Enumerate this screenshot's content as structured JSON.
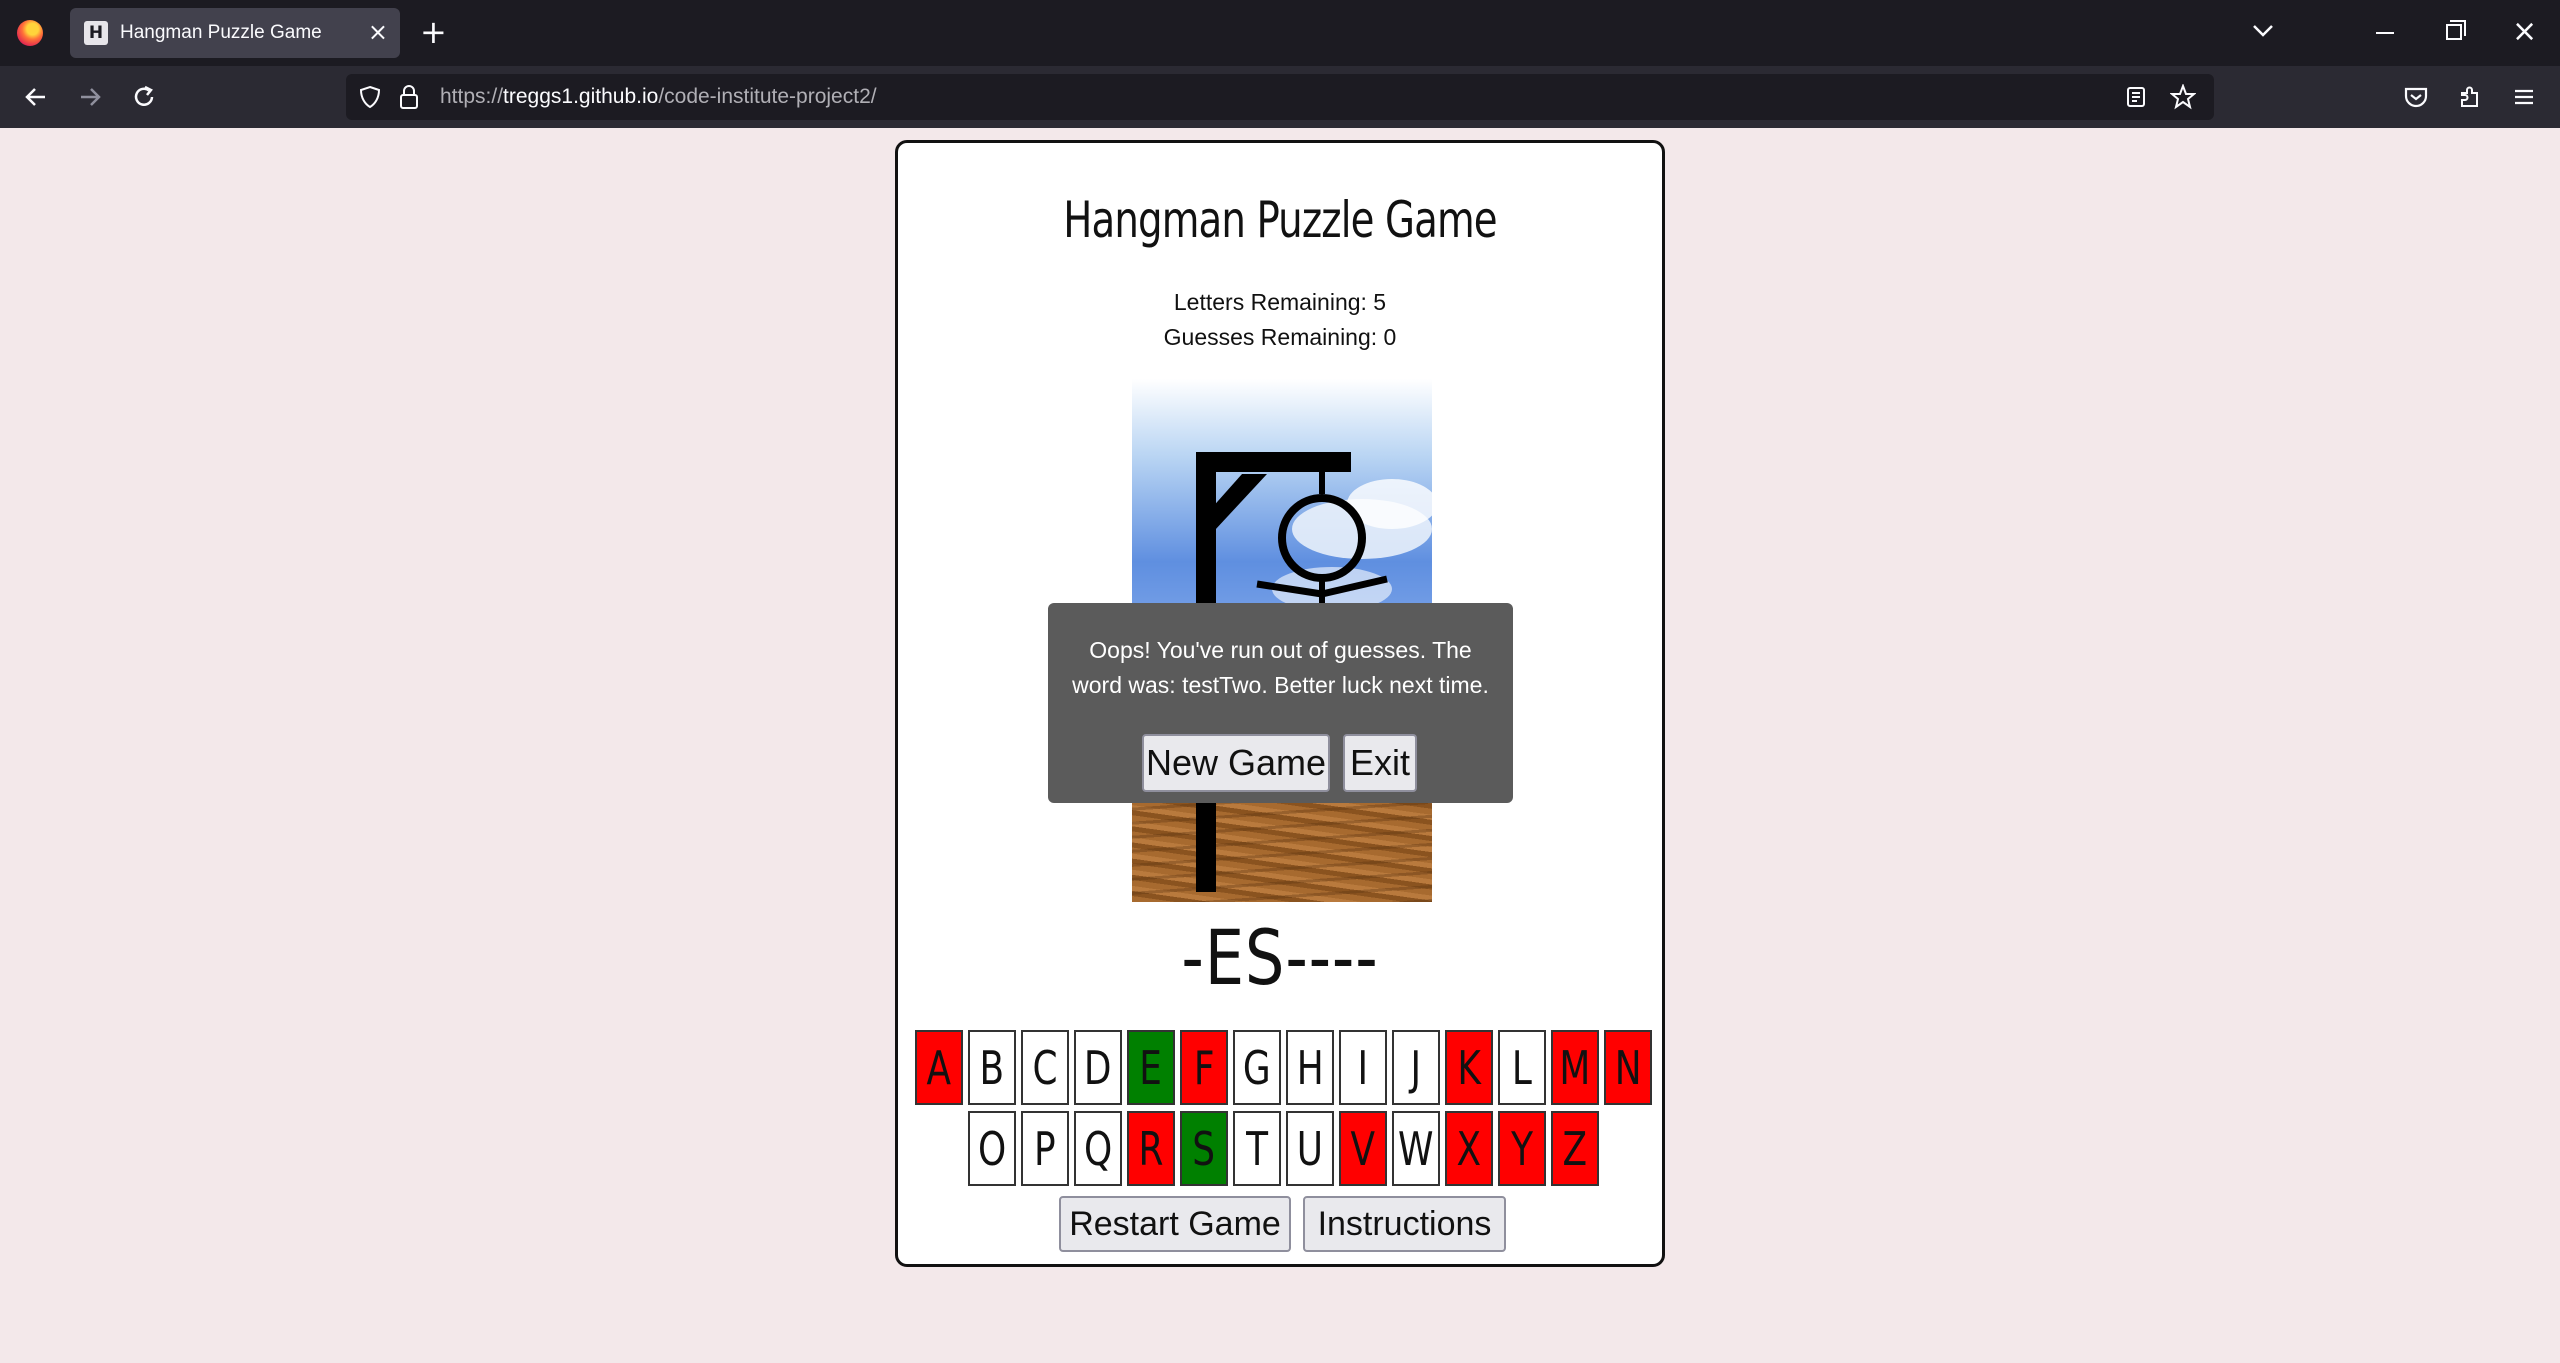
{
  "browser": {
    "tab_title": "Hangman Puzzle Game",
    "tab_favicon_letter": "H",
    "url_scheme": "https://",
    "url_host": "treggs1.github.io",
    "url_path": "/code-institute-project2/"
  },
  "game": {
    "title": "Hangman Puzzle Game",
    "letters_remaining": "Letters Remaining: 5",
    "guesses_remaining": "Guesses Remaining: 0",
    "word_display": "-ES----",
    "keyboard_row1": [
      {
        "letter": "A",
        "state": "wrong"
      },
      {
        "letter": "B",
        "state": "unused"
      },
      {
        "letter": "C",
        "state": "unused"
      },
      {
        "letter": "D",
        "state": "unused"
      },
      {
        "letter": "E",
        "state": "right"
      },
      {
        "letter": "F",
        "state": "wrong"
      },
      {
        "letter": "G",
        "state": "unused"
      },
      {
        "letter": "H",
        "state": "unused"
      },
      {
        "letter": "I",
        "state": "unused"
      },
      {
        "letter": "J",
        "state": "unused"
      },
      {
        "letter": "K",
        "state": "wrong"
      },
      {
        "letter": "L",
        "state": "unused"
      },
      {
        "letter": "M",
        "state": "wrong"
      },
      {
        "letter": "N",
        "state": "wrong"
      }
    ],
    "keyboard_row2": [
      {
        "letter": "O",
        "state": "unused"
      },
      {
        "letter": "P",
        "state": "unused"
      },
      {
        "letter": "Q",
        "state": "unused"
      },
      {
        "letter": "R",
        "state": "wrong"
      },
      {
        "letter": "S",
        "state": "right"
      },
      {
        "letter": "T",
        "state": "unused"
      },
      {
        "letter": "U",
        "state": "unused"
      },
      {
        "letter": "V",
        "state": "wrong"
      },
      {
        "letter": "W",
        "state": "unused"
      },
      {
        "letter": "X",
        "state": "wrong"
      },
      {
        "letter": "Y",
        "state": "wrong"
      },
      {
        "letter": "Z",
        "state": "wrong"
      }
    ],
    "restart_label": "Restart Game",
    "instructions_label": "Instructions"
  },
  "modal": {
    "message": "Oops! You've run out of guesses. The word was: testTwo. Better luck next time.",
    "new_game_label": "New Game",
    "exit_label": "Exit"
  },
  "colors": {
    "wrong": "#ff0000",
    "right": "#008000",
    "page_bg": "#f3e8ea"
  }
}
